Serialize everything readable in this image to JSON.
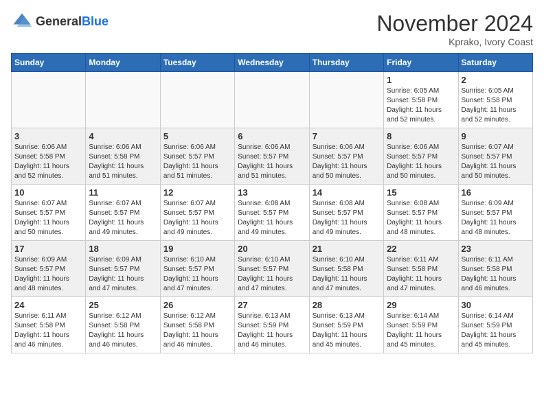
{
  "header": {
    "logo_line1": "General",
    "logo_line2": "Blue",
    "month": "November 2024",
    "location": "Kprako, Ivory Coast"
  },
  "days_of_week": [
    "Sunday",
    "Monday",
    "Tuesday",
    "Wednesday",
    "Thursday",
    "Friday",
    "Saturday"
  ],
  "weeks": [
    {
      "shaded": false,
      "days": [
        {
          "date": "",
          "info": ""
        },
        {
          "date": "",
          "info": ""
        },
        {
          "date": "",
          "info": ""
        },
        {
          "date": "",
          "info": ""
        },
        {
          "date": "",
          "info": ""
        },
        {
          "date": "1",
          "info": "Sunrise: 6:05 AM\nSunset: 5:58 PM\nDaylight: 11 hours\nand 52 minutes."
        },
        {
          "date": "2",
          "info": "Sunrise: 6:05 AM\nSunset: 5:58 PM\nDaylight: 11 hours\nand 52 minutes."
        }
      ]
    },
    {
      "shaded": true,
      "days": [
        {
          "date": "3",
          "info": "Sunrise: 6:06 AM\nSunset: 5:58 PM\nDaylight: 11 hours\nand 52 minutes."
        },
        {
          "date": "4",
          "info": "Sunrise: 6:06 AM\nSunset: 5:58 PM\nDaylight: 11 hours\nand 51 minutes."
        },
        {
          "date": "5",
          "info": "Sunrise: 6:06 AM\nSunset: 5:57 PM\nDaylight: 11 hours\nand 51 minutes."
        },
        {
          "date": "6",
          "info": "Sunrise: 6:06 AM\nSunset: 5:57 PM\nDaylight: 11 hours\nand 51 minutes."
        },
        {
          "date": "7",
          "info": "Sunrise: 6:06 AM\nSunset: 5:57 PM\nDaylight: 11 hours\nand 50 minutes."
        },
        {
          "date": "8",
          "info": "Sunrise: 6:06 AM\nSunset: 5:57 PM\nDaylight: 11 hours\nand 50 minutes."
        },
        {
          "date": "9",
          "info": "Sunrise: 6:07 AM\nSunset: 5:57 PM\nDaylight: 11 hours\nand 50 minutes."
        }
      ]
    },
    {
      "shaded": false,
      "days": [
        {
          "date": "10",
          "info": "Sunrise: 6:07 AM\nSunset: 5:57 PM\nDaylight: 11 hours\nand 50 minutes."
        },
        {
          "date": "11",
          "info": "Sunrise: 6:07 AM\nSunset: 5:57 PM\nDaylight: 11 hours\nand 49 minutes."
        },
        {
          "date": "12",
          "info": "Sunrise: 6:07 AM\nSunset: 5:57 PM\nDaylight: 11 hours\nand 49 minutes."
        },
        {
          "date": "13",
          "info": "Sunrise: 6:08 AM\nSunset: 5:57 PM\nDaylight: 11 hours\nand 49 minutes."
        },
        {
          "date": "14",
          "info": "Sunrise: 6:08 AM\nSunset: 5:57 PM\nDaylight: 11 hours\nand 49 minutes."
        },
        {
          "date": "15",
          "info": "Sunrise: 6:08 AM\nSunset: 5:57 PM\nDaylight: 11 hours\nand 48 minutes."
        },
        {
          "date": "16",
          "info": "Sunrise: 6:09 AM\nSunset: 5:57 PM\nDaylight: 11 hours\nand 48 minutes."
        }
      ]
    },
    {
      "shaded": true,
      "days": [
        {
          "date": "17",
          "info": "Sunrise: 6:09 AM\nSunset: 5:57 PM\nDaylight: 11 hours\nand 48 minutes."
        },
        {
          "date": "18",
          "info": "Sunrise: 6:09 AM\nSunset: 5:57 PM\nDaylight: 11 hours\nand 47 minutes."
        },
        {
          "date": "19",
          "info": "Sunrise: 6:10 AM\nSunset: 5:57 PM\nDaylight: 11 hours\nand 47 minutes."
        },
        {
          "date": "20",
          "info": "Sunrise: 6:10 AM\nSunset: 5:57 PM\nDaylight: 11 hours\nand 47 minutes."
        },
        {
          "date": "21",
          "info": "Sunrise: 6:10 AM\nSunset: 5:58 PM\nDaylight: 11 hours\nand 47 minutes."
        },
        {
          "date": "22",
          "info": "Sunrise: 6:11 AM\nSunset: 5:58 PM\nDaylight: 11 hours\nand 47 minutes."
        },
        {
          "date": "23",
          "info": "Sunrise: 6:11 AM\nSunset: 5:58 PM\nDaylight: 11 hours\nand 46 minutes."
        }
      ]
    },
    {
      "shaded": false,
      "days": [
        {
          "date": "24",
          "info": "Sunrise: 6:11 AM\nSunset: 5:58 PM\nDaylight: 11 hours\nand 46 minutes."
        },
        {
          "date": "25",
          "info": "Sunrise: 6:12 AM\nSunset: 5:58 PM\nDaylight: 11 hours\nand 46 minutes."
        },
        {
          "date": "26",
          "info": "Sunrise: 6:12 AM\nSunset: 5:58 PM\nDaylight: 11 hours\nand 46 minutes."
        },
        {
          "date": "27",
          "info": "Sunrise: 6:13 AM\nSunset: 5:59 PM\nDaylight: 11 hours\nand 46 minutes."
        },
        {
          "date": "28",
          "info": "Sunrise: 6:13 AM\nSunset: 5:59 PM\nDaylight: 11 hours\nand 45 minutes."
        },
        {
          "date": "29",
          "info": "Sunrise: 6:14 AM\nSunset: 5:59 PM\nDaylight: 11 hours\nand 45 minutes."
        },
        {
          "date": "30",
          "info": "Sunrise: 6:14 AM\nSunset: 5:59 PM\nDaylight: 11 hours\nand 45 minutes."
        }
      ]
    }
  ]
}
